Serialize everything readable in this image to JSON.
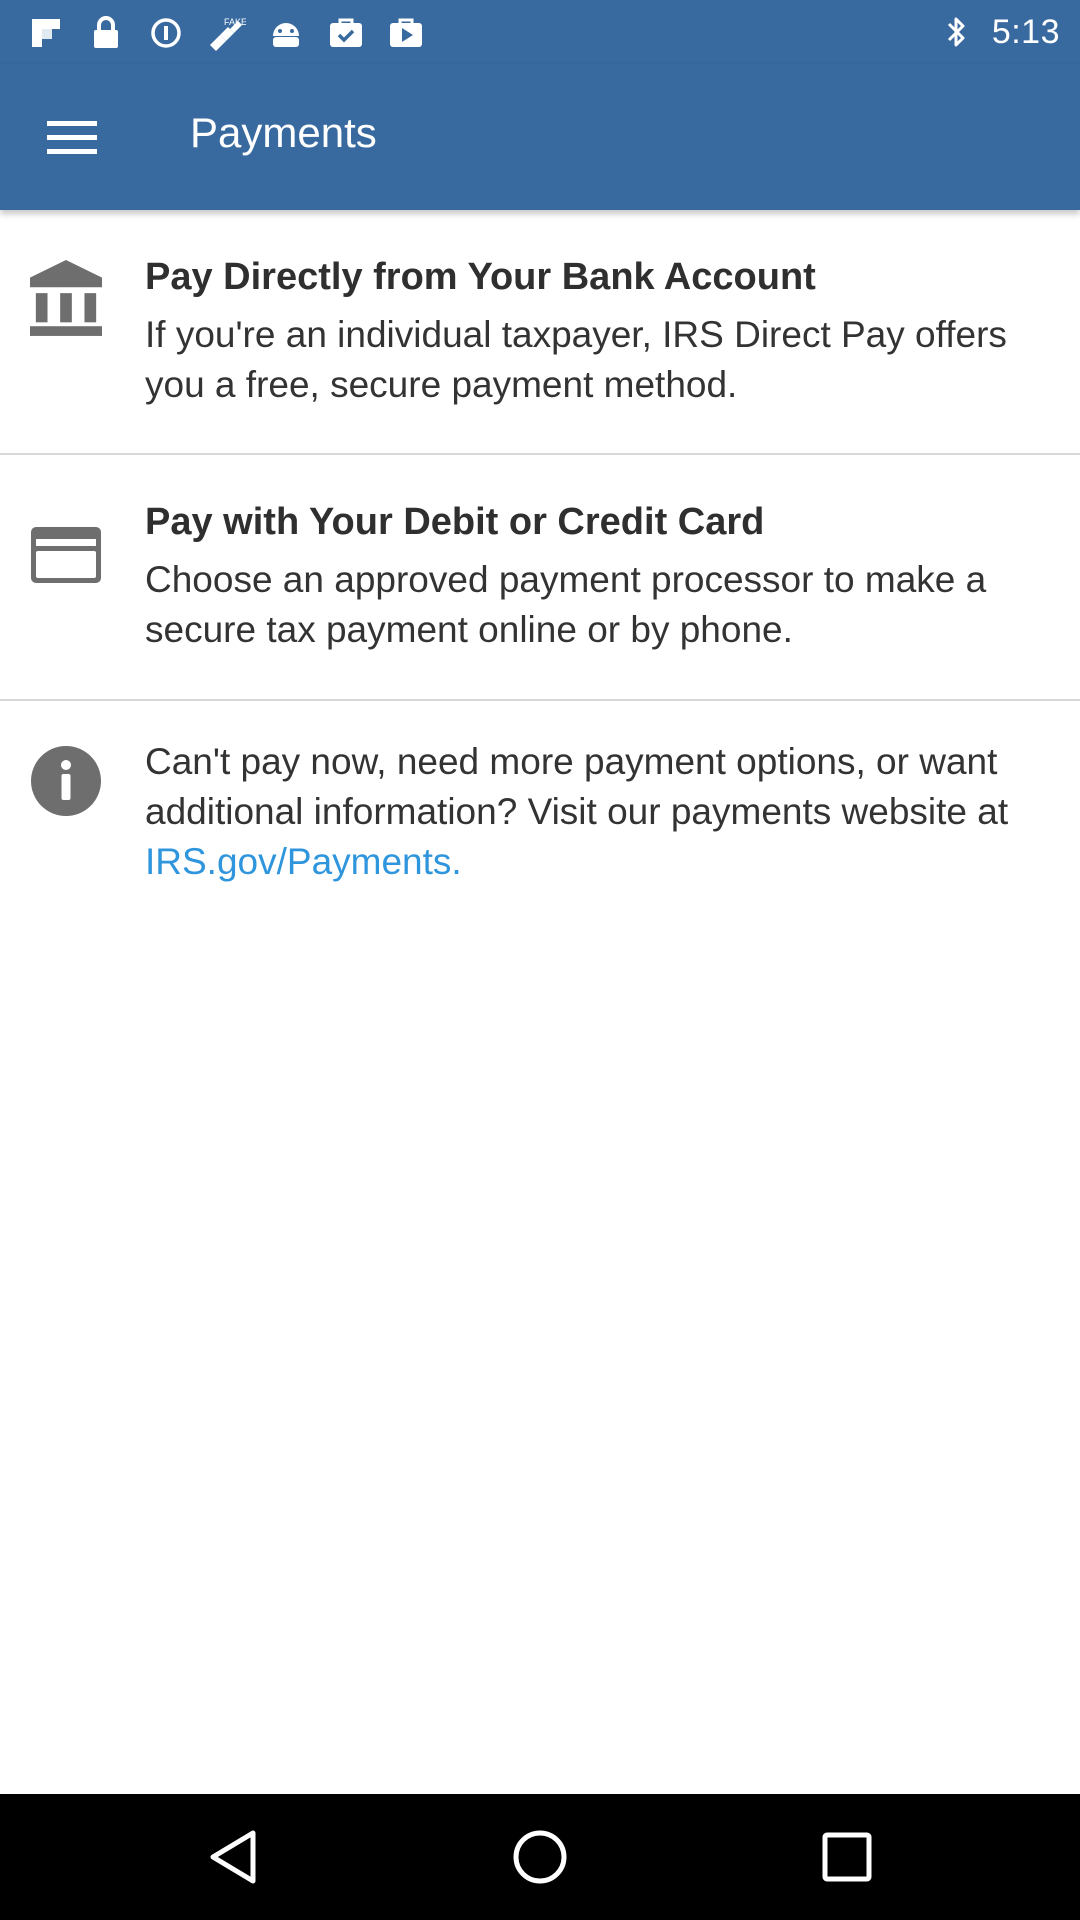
{
  "status_bar": {
    "time": "5:13",
    "left_icons": [
      "flipboard-icon",
      "lock-icon",
      "data-saver-icon",
      "fake-gps-icon",
      "android-icon",
      "briefcase-check-icon",
      "play-store-icon"
    ],
    "right_icons": [
      "bluetooth-icon"
    ]
  },
  "app_bar": {
    "menu_icon": "hamburger-menu-icon",
    "title": "Payments",
    "background": "#386a9f"
  },
  "payment_options": [
    {
      "icon": "bank-icon",
      "title": "Pay Directly from Your Bank Account",
      "description": "If you're an individual taxpayer, IRS Direct Pay offers you a free, secure payment method."
    },
    {
      "icon": "credit-card-icon",
      "title": "Pay with Your Debit or Credit Card",
      "description": "Choose an approved payment processor to make a secure tax payment online or by phone."
    },
    {
      "icon": "info-icon",
      "description_prefix": "Can't pay now, need more payment options, or want additional information? Visit our payments website at ",
      "link_text": "IRS.gov/Payments.",
      "link_color": "#2f95dc"
    }
  ],
  "nav_bar": {
    "icons": [
      "back-triangle-icon",
      "home-circle-icon",
      "recents-square-icon"
    ]
  }
}
